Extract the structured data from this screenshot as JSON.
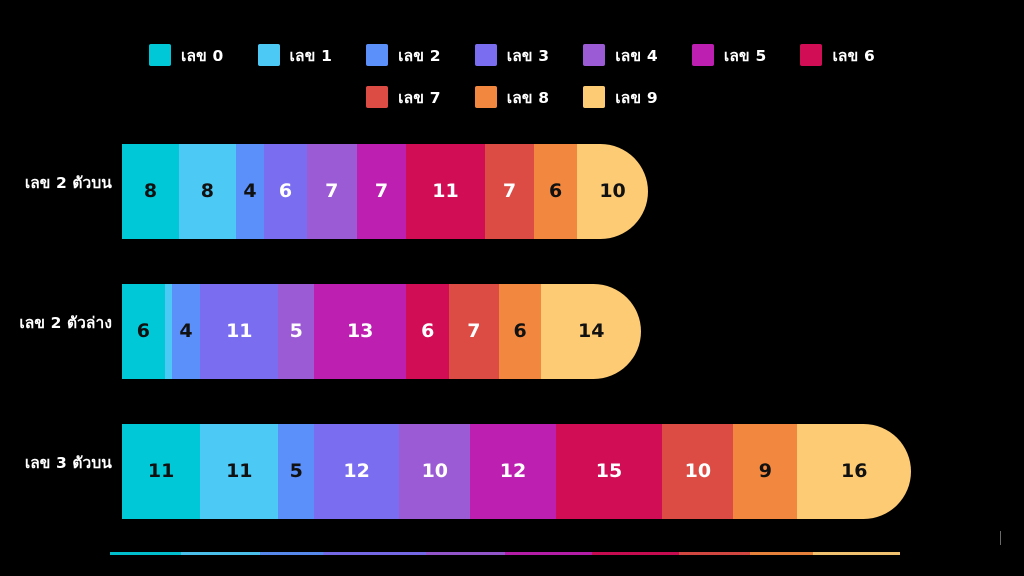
{
  "chart_data": {
    "type": "bar",
    "orientation": "horizontal",
    "stacked": true,
    "title": "",
    "subtitle": "",
    "xlabel": "",
    "ylabel": "",
    "grid": false,
    "legend_position": "top",
    "background_color": "#000000",
    "categories": [
      "เลข 2 ตัวบน",
      "เลข 2 ตัวล่าง",
      "เลข 3 ตัวบน"
    ],
    "legend": [
      {
        "label": "เลข 0",
        "color": "#00c8d7"
      },
      {
        "label": "เลข 1",
        "color": "#4dc9f6"
      },
      {
        "label": "เลข 2",
        "color": "#5b8ff9"
      },
      {
        "label": "เลข 3",
        "color": "#7b6df0"
      },
      {
        "label": "เลข 4",
        "color": "#9b5bd5"
      },
      {
        "label": "เลข 5",
        "color": "#bd1fb0"
      },
      {
        "label": "เลข 6",
        "color": "#d10d55"
      },
      {
        "label": "เลข 7",
        "color": "#dc4b44"
      },
      {
        "label": "เลข 8",
        "color": "#f2883f"
      },
      {
        "label": "เลข 9",
        "color": "#fccb74"
      }
    ],
    "series": [
      {
        "name": "เลข 0",
        "color": "#00c8d7",
        "values": [
          8,
          6,
          11
        ]
      },
      {
        "name": "เลข 1",
        "color": "#4dc9f6",
        "values": [
          8,
          1,
          11
        ]
      },
      {
        "name": "เลข 2",
        "color": "#5b8ff9",
        "values": [
          4,
          4,
          5
        ]
      },
      {
        "name": "เลข 3",
        "color": "#7b6df0",
        "values": [
          6,
          11,
          12
        ]
      },
      {
        "name": "เลข 4",
        "color": "#9b5bd5",
        "values": [
          7,
          5,
          10
        ]
      },
      {
        "name": "เลข 5",
        "color": "#bd1fb0",
        "values": [
          7,
          13,
          12
        ]
      },
      {
        "name": "เลข 6",
        "color": "#d10d55",
        "values": [
          11,
          6,
          15
        ]
      },
      {
        "name": "เลข 7",
        "color": "#dc4b44",
        "values": [
          7,
          7,
          10
        ]
      },
      {
        "name": "เลข 8",
        "color": "#f2883f",
        "values": [
          6,
          6,
          9
        ]
      },
      {
        "name": "เลข 9",
        "color": "#fccb74",
        "values": [
          10,
          14,
          16
        ]
      }
    ],
    "row_totals": [
      74,
      73,
      111
    ],
    "rows": [
      {
        "label": "เลข 2 ตัวบน",
        "total": 74,
        "segments": [
          {
            "series": "เลข 0",
            "value": 8,
            "label": "8",
            "color": "#00c8d7",
            "text_color": "#111111"
          },
          {
            "series": "เลข 1",
            "value": 8,
            "label": "8",
            "color": "#4dc9f6",
            "text_color": "#111111"
          },
          {
            "series": "เลข 2",
            "value": 4,
            "label": "4",
            "color": "#5b8ff9",
            "text_color": "#111111"
          },
          {
            "series": "เลข 3",
            "value": 6,
            "label": "6",
            "color": "#7b6df0",
            "text_color": "#ffffff"
          },
          {
            "series": "เลข 4",
            "value": 7,
            "label": "7",
            "color": "#9b5bd5",
            "text_color": "#ffffff"
          },
          {
            "series": "เลข 5",
            "value": 7,
            "label": "7",
            "color": "#bd1fb0",
            "text_color": "#ffffff"
          },
          {
            "series": "เลข 6",
            "value": 11,
            "label": "11",
            "color": "#d10d55",
            "text_color": "#ffffff"
          },
          {
            "series": "เลข 7",
            "value": 7,
            "label": "7",
            "color": "#dc4b44",
            "text_color": "#ffffff"
          },
          {
            "series": "เลข 8",
            "value": 6,
            "label": "6",
            "color": "#f2883f",
            "text_color": "#111111"
          },
          {
            "series": "เลข 9",
            "value": 10,
            "label": "10",
            "color": "#fccb74",
            "text_color": "#111111"
          }
        ]
      },
      {
        "label": "เลข 2 ตัวล่าง",
        "total": 73,
        "segments": [
          {
            "series": "เลข 0",
            "value": 6,
            "label": "6",
            "color": "#00c8d7",
            "text_color": "#111111"
          },
          {
            "series": "เลข 1",
            "value": 1,
            "label": "",
            "color": "#4dc9f6",
            "text_color": "#111111"
          },
          {
            "series": "เลข 2",
            "value": 4,
            "label": "4",
            "color": "#5b8ff9",
            "text_color": "#111111"
          },
          {
            "series": "เลข 3",
            "value": 11,
            "label": "11",
            "color": "#7b6df0",
            "text_color": "#ffffff"
          },
          {
            "series": "เลข 4",
            "value": 5,
            "label": "5",
            "color": "#9b5bd5",
            "text_color": "#ffffff"
          },
          {
            "series": "เลข 5",
            "value": 13,
            "label": "13",
            "color": "#bd1fb0",
            "text_color": "#ffffff"
          },
          {
            "series": "เลข 6",
            "value": 6,
            "label": "6",
            "color": "#d10d55",
            "text_color": "#ffffff"
          },
          {
            "series": "เลข 7",
            "value": 7,
            "label": "7",
            "color": "#dc4b44",
            "text_color": "#ffffff"
          },
          {
            "series": "เลข 8",
            "value": 6,
            "label": "6",
            "color": "#f2883f",
            "text_color": "#111111"
          },
          {
            "series": "เลข 9",
            "value": 14,
            "label": "14",
            "color": "#fccb74",
            "text_color": "#111111"
          }
        ]
      },
      {
        "label": "เลข 3 ตัวบน",
        "total": 111,
        "segments": [
          {
            "series": "เลข 0",
            "value": 11,
            "label": "11",
            "color": "#00c8d7",
            "text_color": "#111111"
          },
          {
            "series": "เลข 1",
            "value": 11,
            "label": "11",
            "color": "#4dc9f6",
            "text_color": "#111111"
          },
          {
            "series": "เลข 2",
            "value": 5,
            "label": "5",
            "color": "#5b8ff9",
            "text_color": "#111111"
          },
          {
            "series": "เลข 3",
            "value": 12,
            "label": "12",
            "color": "#7b6df0",
            "text_color": "#ffffff"
          },
          {
            "series": "เลข 4",
            "value": 10,
            "label": "10",
            "color": "#9b5bd5",
            "text_color": "#ffffff"
          },
          {
            "series": "เลข 5",
            "value": 12,
            "label": "12",
            "color": "#bd1fb0",
            "text_color": "#ffffff"
          },
          {
            "series": "เลข 6",
            "value": 15,
            "label": "15",
            "color": "#d10d55",
            "text_color": "#ffffff"
          },
          {
            "series": "เลข 7",
            "value": 10,
            "label": "10",
            "color": "#dc4b44",
            "text_color": "#ffffff"
          },
          {
            "series": "เลข 8",
            "value": 9,
            "label": "9",
            "color": "#f2883f",
            "text_color": "#111111"
          },
          {
            "series": "เลข 9",
            "value": 16,
            "label": "16",
            "color": "#fccb74",
            "text_color": "#111111"
          }
        ]
      }
    ]
  }
}
